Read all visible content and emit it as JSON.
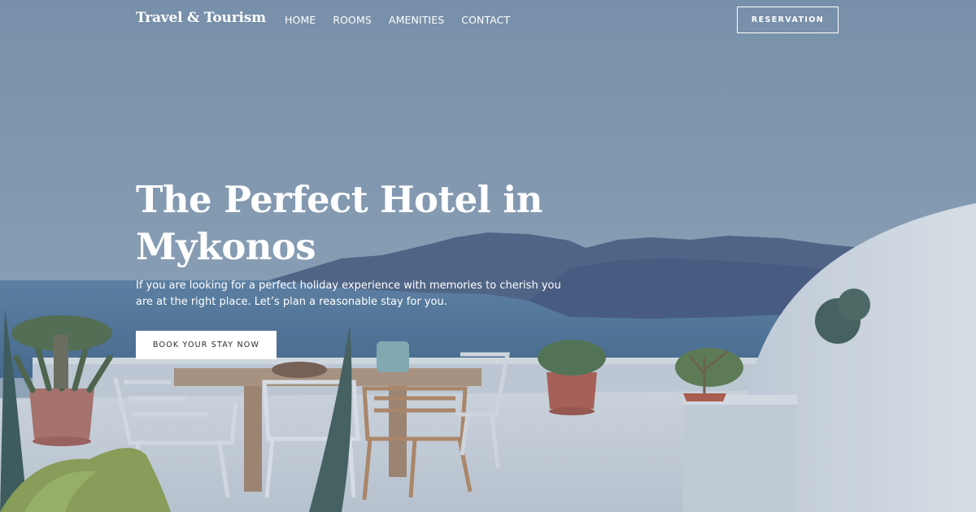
{
  "header": {
    "brand": "Travel & Tourism",
    "nav": [
      "HOME",
      "ROOMS",
      "AMENITIES",
      "CONTACT"
    ],
    "reservation_label": "RESERVATION"
  },
  "hero": {
    "headline": "The Perfect Hotel in Mykonos",
    "lead": "If you are looking for a perfect holiday experience with memories to cherish you are at the right place. Let’s plan a reasonable stay for you.",
    "cta_label": "BOOK YOUR STAY NOW",
    "background_image": "terrace-sea-view-photo"
  },
  "colors": {
    "sky_overlay": "#7e95ad",
    "sea": "#4c6f95",
    "cliffs": "#4a5c7e",
    "terrace": "#d9dde3",
    "accent_text": "#ffffff",
    "button_text": "#2b2b2b"
  }
}
